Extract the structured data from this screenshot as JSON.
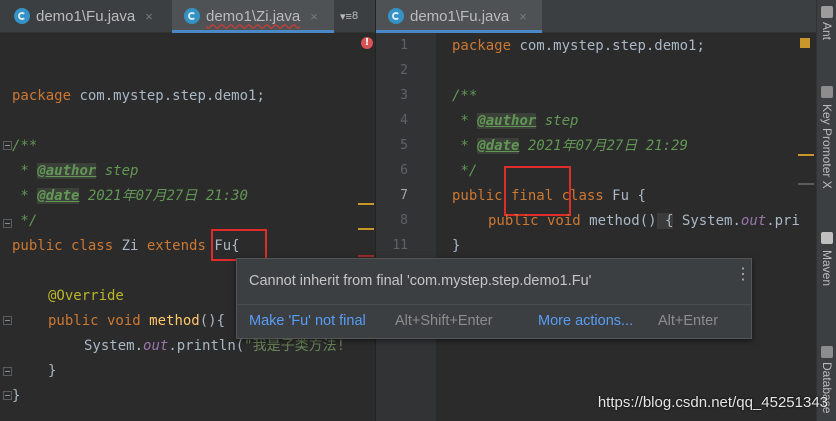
{
  "tabs_left": [
    {
      "label": "demo1\\Fu.java",
      "close": "×",
      "active": false
    },
    {
      "label": "demo1\\Zi.java",
      "close": "×",
      "active": true
    }
  ],
  "tabs_overflow": "8",
  "tabs_right": [
    {
      "label": "demo1\\Fu.java",
      "close": "×",
      "active": true
    }
  ],
  "error_mark": "!",
  "left_code": {
    "package_kw": "package",
    "package_name": " com.mystep.step.demo1;",
    "doc_open": "/**",
    "doc_author_prefix": " * ",
    "doc_author_tag": "@author",
    "doc_author_val": " step",
    "doc_date_prefix": " * ",
    "doc_date_tag": "@date",
    "doc_date_val": " 2021年07月27日 21:30",
    "doc_close": " */",
    "class_public": "public",
    "class_class": " class",
    "class_name": " Zi",
    "class_extends": " extends",
    "class_super": " Fu{",
    "override": "@Override",
    "m_public": "public",
    "m_void": " void",
    "m_name": " method",
    "m_rest": "(){",
    "sys_pre": "System.",
    "sys_out": "out",
    "sys_post": ".println(",
    "sys_str": "\"我是子类方法!",
    "close1": "}",
    "close2": "}"
  },
  "right_code": {
    "line_numbers": [
      "1",
      "2",
      "3",
      "4",
      "5",
      "6",
      "7",
      "8",
      "11"
    ],
    "package_kw": "package",
    "package_name": " com.mystep.step.demo1;",
    "doc_open": "/**",
    "doc_author_prefix": " * ",
    "doc_author_tag": "@author",
    "doc_author_val": " step",
    "doc_date_prefix": " * ",
    "doc_date_tag": "@date",
    "doc_date_val": " 2021年07月27日 21:29",
    "doc_close": " */",
    "c_public": "public",
    "c_final": " final",
    "c_class": " class",
    "c_name": " Fu {",
    "m_public": "public",
    "m_void": " void",
    "m_name": " method",
    "m_paren": "()",
    "m_body_open": " {",
    "m_sys": " System.",
    "m_out": "out",
    "m_pr": ".pri",
    "close": "}"
  },
  "popup": {
    "message": "Cannot inherit from final 'com.mystep.step.demo1.Fu'",
    "action1": "Make 'Fu' not final",
    "shortcut1": "Alt+Shift+Enter",
    "action2": "More actions...",
    "shortcut2": "Alt+Enter",
    "menu": "⋮"
  },
  "sidebar": {
    "ant": "Ant",
    "key_promoter": "Key Promoter X",
    "maven": "Maven",
    "database": "Database"
  },
  "watermark": "https://blog.csdn.net/qq_45251343",
  "colors": {
    "background": "#2b2b2b",
    "keyword": "#cc7832",
    "comment": "#629755",
    "annotation": "#bbb529",
    "link": "#589df6",
    "highlight_box": "#e02b2b"
  }
}
